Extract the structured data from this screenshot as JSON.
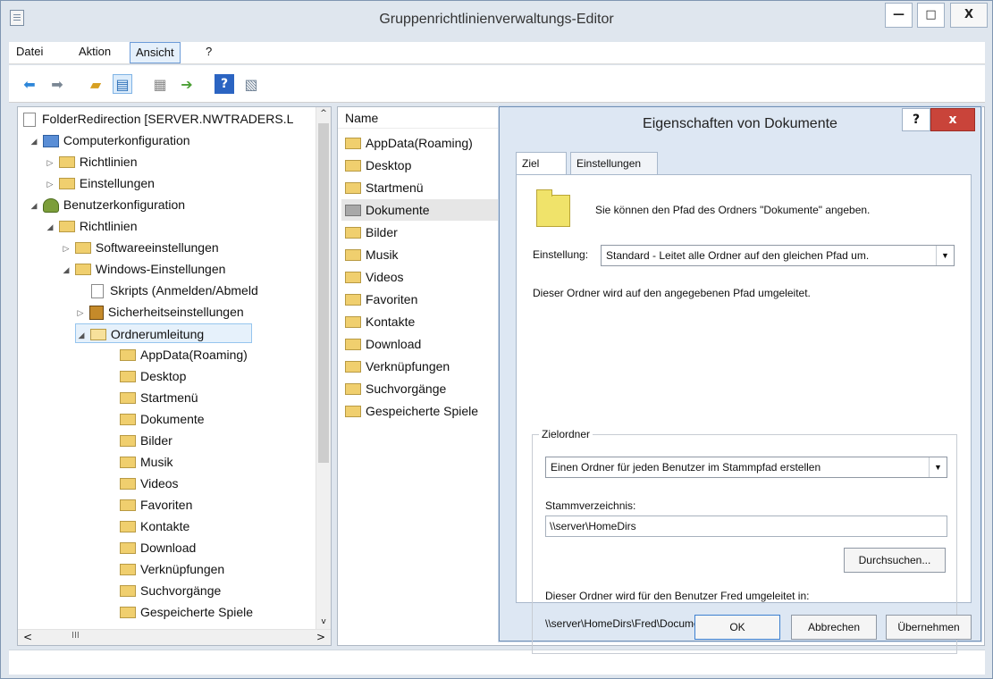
{
  "window": {
    "title": "Gruppenrichtlinienverwaltungs-Editor",
    "minimize_label": "—",
    "maximize_label": "□",
    "close_label": "X"
  },
  "menu": {
    "items": [
      "Datei",
      "Aktion",
      "Ansicht",
      "?"
    ]
  },
  "toolbar": {
    "icons": [
      "back-arrow-icon",
      "forward-arrow-icon",
      "up-folder-icon",
      "show-hide-tree-icon",
      "properties-icon",
      "export-list-icon",
      "help-icon",
      "view-icon"
    ]
  },
  "tree": {
    "root": "FolderRedirection [SERVER.NWTRADERS.L",
    "nodes": [
      {
        "label": "Computerkonfiguration",
        "icon": "computer-icon",
        "arrow": "◢"
      },
      {
        "label": "Richtlinien",
        "icon": "folder-icon",
        "arrow": "▷"
      },
      {
        "label": "Einstellungen",
        "icon": "folder-icon",
        "arrow": "▷"
      },
      {
        "label": "Benutzerkonfiguration",
        "icon": "user-icon",
        "arrow": "◢"
      },
      {
        "label": "Richtlinien",
        "icon": "folder-icon",
        "arrow": "◢"
      },
      {
        "label": "Softwareeinstellungen",
        "icon": "folder-icon",
        "arrow": "▷"
      },
      {
        "label": "Windows-Einstellungen",
        "icon": "folder-icon",
        "arrow": "◢"
      },
      {
        "label": "Skripts (Anmelden/Abmeld",
        "icon": "script-icon",
        "arrow": ""
      },
      {
        "label": "Sicherheitseinstellungen",
        "icon": "security-icon",
        "arrow": "▷"
      },
      {
        "label": "Ordnerumleitung",
        "icon": "folder-open-icon",
        "arrow": "◢"
      },
      {
        "label": "AppData(Roaming)",
        "icon": "folder-icon",
        "arrow": ""
      },
      {
        "label": "Desktop",
        "icon": "folder-icon",
        "arrow": ""
      },
      {
        "label": "Startmenü",
        "icon": "folder-icon",
        "arrow": ""
      },
      {
        "label": "Dokumente",
        "icon": "folder-icon",
        "arrow": ""
      },
      {
        "label": "Bilder",
        "icon": "folder-icon",
        "arrow": ""
      },
      {
        "label": "Musik",
        "icon": "folder-icon",
        "arrow": ""
      },
      {
        "label": "Videos",
        "icon": "folder-icon",
        "arrow": ""
      },
      {
        "label": "Favoriten",
        "icon": "folder-icon",
        "arrow": ""
      },
      {
        "label": "Kontakte",
        "icon": "folder-icon",
        "arrow": ""
      },
      {
        "label": "Download",
        "icon": "folder-icon",
        "arrow": ""
      },
      {
        "label": "Verknüpfungen",
        "icon": "folder-icon",
        "arrow": ""
      },
      {
        "label": "Suchvorgänge",
        "icon": "folder-icon",
        "arrow": ""
      },
      {
        "label": "Gespeicherte Spiele",
        "icon": "folder-icon",
        "arrow": ""
      }
    ],
    "scroll_left": "<",
    "scroll_right": ">",
    "scroll_thumb": "III",
    "scroll_up": "^",
    "scroll_down": "v"
  },
  "list": {
    "header": "Name",
    "items": [
      "AppData(Roaming)",
      "Desktop",
      "Startmenü",
      "Dokumente",
      "Bilder",
      "Musik",
      "Videos",
      "Favoriten",
      "Kontakte",
      "Download",
      "Verknüpfungen",
      "Suchvorgänge",
      "Gespeicherte Spiele"
    ]
  },
  "dialog": {
    "title": "Eigenschaften von Dokumente",
    "help_label": "?",
    "close_label": "x",
    "tabs": [
      "Ziel",
      "Einstellungen"
    ],
    "intro": "Sie können den Pfad des Ordners \"Dokumente\" angeben.",
    "setting_label": "Einstellung:",
    "setting_value": "Standard - Leitet alle Ordner auf den gleichen Pfad um.",
    "redirect_text": "Dieser Ordner wird auf den angegebenen Pfad umgeleitet.",
    "target_group": "Zielordner",
    "target_value": "Einen Ordner für jeden Benutzer im Stammpfad erstellen",
    "root_label": "Stammverzeichnis:",
    "root_value": "\\\\server\\HomeDirs",
    "browse_label": "Durchsuchen...",
    "user_redirect": "Dieser Ordner wird für den Benutzer Fred umgeleitet in:",
    "user_path": "\\\\server\\HomeDirs\\Fred\\Documents",
    "ok_label": "OK",
    "cancel_label": "Abbrechen",
    "apply_label": "Übernehmen"
  }
}
